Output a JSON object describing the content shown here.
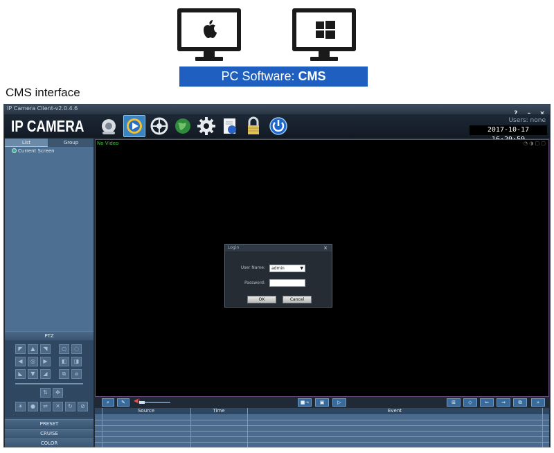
{
  "banner": {
    "prefix": "PC Software: ",
    "product": "CMS"
  },
  "section_heading": "CMS interface",
  "icons": {
    "mac_monitor": "apple-monitor-icon",
    "windows_monitor": "windows-monitor-icon"
  },
  "app": {
    "window_title": "IP Camera Client-v2.0.4.6",
    "window_controls": [
      "?",
      "–",
      "×"
    ],
    "brand": "IP CAMERA",
    "users_label": "Users: none",
    "datetime": "2017-10-17  16:29:59",
    "toolbar_icons": [
      "camera-icon",
      "play-icon",
      "ptz-settings-icon",
      "globe-icon",
      "gear-icon",
      "record-file-icon",
      "lock-icon",
      "power-icon"
    ],
    "active_toolbar_index": 1,
    "tabs": {
      "list": "List",
      "group": "Group"
    },
    "tree_item": "Current Screen",
    "ptz_label": "PTZ",
    "bottom_buttons": {
      "preset": "PRESET",
      "cruise": "CRUISE",
      "color": "COLOR"
    },
    "video_status": "No Video",
    "login": {
      "title": "Login",
      "close": "×",
      "username_label": "User Name:",
      "username_value": "admin",
      "password_label": "Password:",
      "ok": "OK",
      "cancel": "Cancel"
    },
    "event_table": {
      "columns": [
        "Source",
        "Time",
        "Event"
      ]
    }
  },
  "colors": {
    "banner_bg": "#1f5fbf",
    "window_bg": "#232a33",
    "video_bg": "#000000",
    "no_video_text": "#3ecb3e",
    "panel_bg": "#4c6f92"
  }
}
